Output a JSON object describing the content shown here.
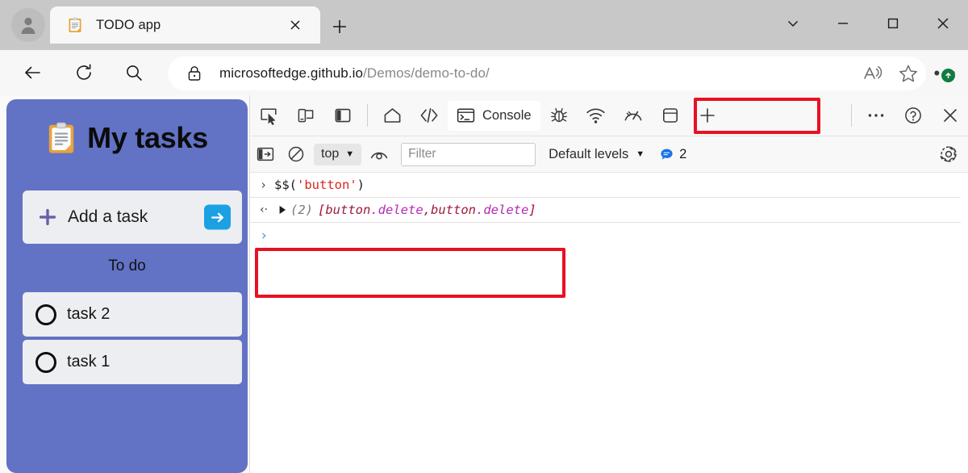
{
  "browser": {
    "profile_icon": "account-avatar-icon",
    "tab": {
      "favicon": "clipboard-icon",
      "title": "TODO app",
      "close_label": "✕"
    },
    "new_tab_label": "+",
    "window_controls": {
      "more": "⌄",
      "minimize": "—",
      "maximize": "□",
      "close": "✕"
    },
    "nav": {
      "back": "back-arrow-icon",
      "reload": "reload-icon",
      "search": "search-icon"
    },
    "address_bar": {
      "lock": "lock-icon",
      "url_host": "microsoftedge.github.io",
      "url_path": "/Demos/demo-to-do/",
      "read_aloud": "read-aloud-icon",
      "favorite": "star-icon"
    },
    "settings_ellipsis": "•••"
  },
  "app": {
    "title": "My tasks",
    "title_icon": "clipboard-icon",
    "add_task": {
      "placeholder": "Add a task",
      "plus_icon": "plus-icon",
      "submit_icon": "arrow-right-icon"
    },
    "section_label": "To do",
    "tasks": [
      {
        "label": "task 2",
        "done": false
      },
      {
        "label": "task 1",
        "done": false
      }
    ],
    "colors": {
      "card": "#6272c4",
      "item": "#eceef1",
      "submit": "#1ba1e2"
    }
  },
  "devtools": {
    "tabbar_icons": [
      "inspect-element-icon",
      "device-emulation-icon",
      "dock-side-icon"
    ],
    "tabs": [
      {
        "label": "",
        "icon": "home-icon",
        "active": false
      },
      {
        "label": "",
        "icon": "elements-icon",
        "active": false
      },
      {
        "label": "Console",
        "icon": "console-terminal-icon",
        "active": true
      },
      {
        "label": "",
        "icon": "debugger-bug-icon",
        "active": false
      },
      {
        "label": "",
        "icon": "network-icon",
        "active": false
      },
      {
        "label": "",
        "icon": "performance-icon",
        "active": false
      },
      {
        "label": "",
        "icon": "application-icon",
        "active": false
      },
      {
        "label": "",
        "icon": "add-tab-plus-icon",
        "active": false
      }
    ],
    "tabbar_right": [
      "more-tools-icon",
      "help-question-icon",
      "close-devtools-icon"
    ],
    "filterbar": {
      "sidebar_toggle": "console-sidebar-icon",
      "clear_console": "clear-console-icon",
      "context": "top",
      "live_expression": "eye-icon",
      "filter_placeholder": "Filter",
      "filter_value": "",
      "levels_label": "Default levels",
      "message_count": "2",
      "message_icon": "speech-bubble-icon",
      "settings": "gear-icon"
    },
    "console": {
      "input_row": {
        "prompt": "›",
        "fn": "$$(",
        "string": "'button'",
        "close": ")"
      },
      "output_row": {
        "prompt": "‹·",
        "disclosure": "▶",
        "count": "(2)",
        "open_bracket": "[",
        "items": [
          {
            "tag": "button",
            "cls": ".delete"
          },
          {
            "tag": "button",
            "cls": ".delete"
          }
        ],
        "separator": ", ",
        "close_bracket": "]"
      },
      "new_prompt": "›"
    },
    "highlight_color": "#e81123"
  }
}
